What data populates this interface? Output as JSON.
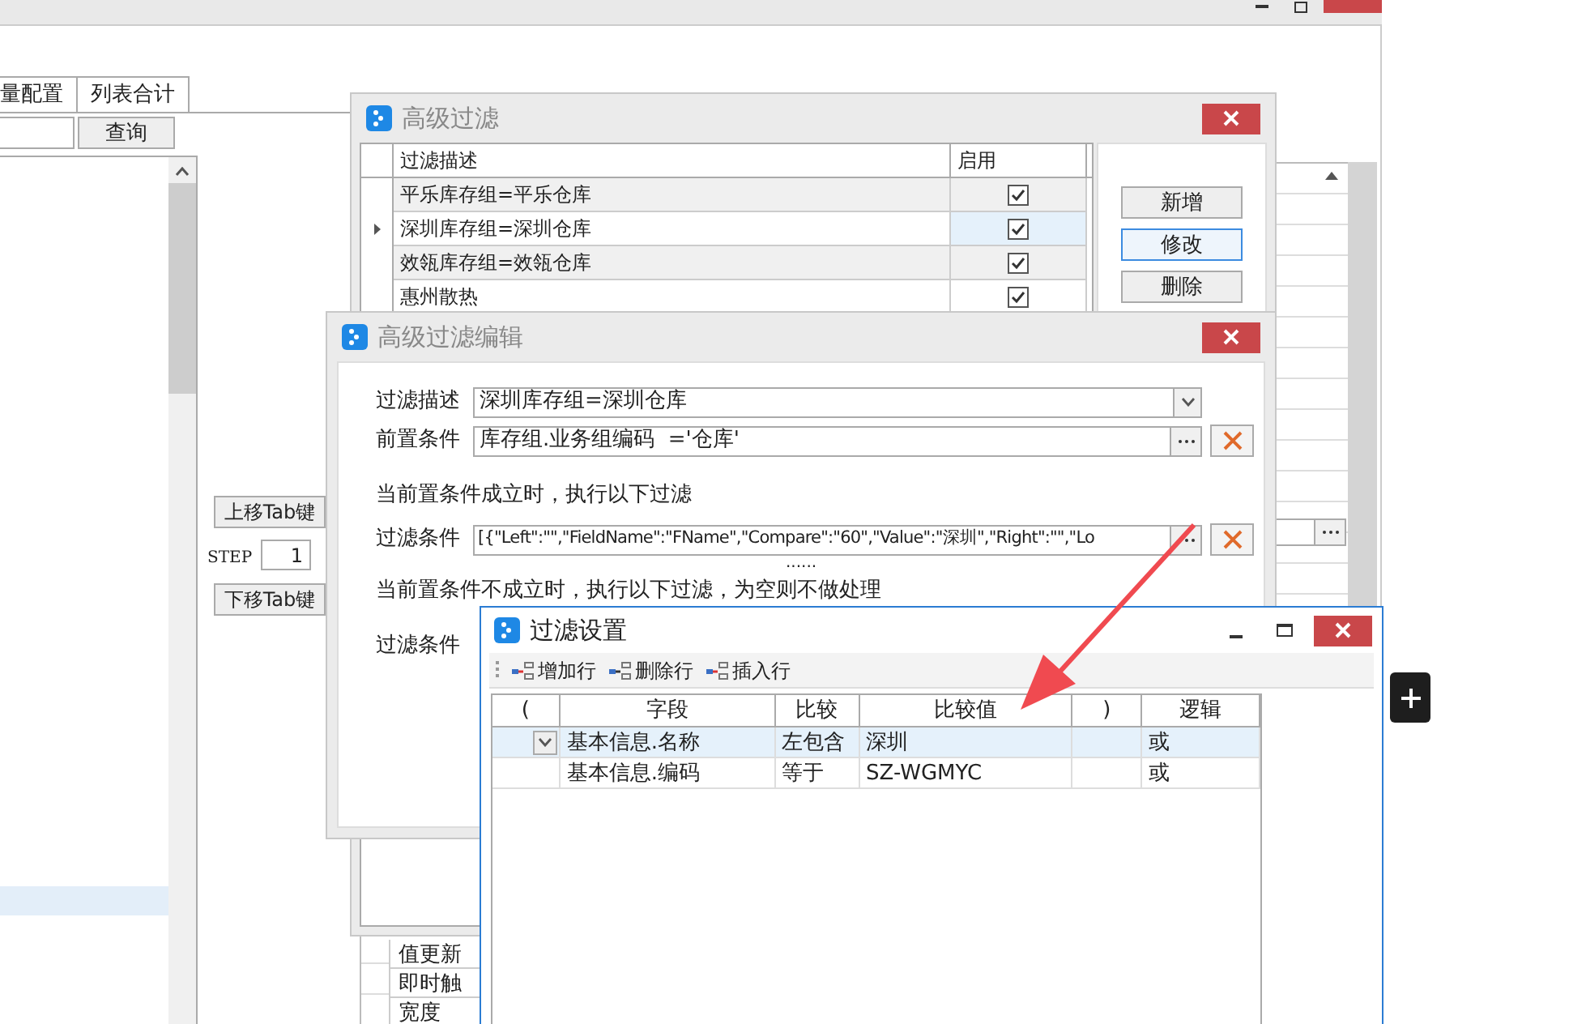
{
  "main_window": {
    "tabs": [
      "量配置",
      "列表合计"
    ],
    "search_button": "查询",
    "move_up_button": "上移Tab键",
    "step_label": "STEP",
    "step_value": "1",
    "move_down_button": "下移Tab键",
    "property_rows": [
      "值更新",
      "即时触",
      "宽度"
    ]
  },
  "advanced_filter": {
    "title": "高级过滤",
    "columns": [
      "过滤描述",
      "启用"
    ],
    "rows": [
      {
        "description": "平乐库存组=平乐仓库",
        "enabled": true,
        "selected": false
      },
      {
        "description": "深圳库存组=深圳仓库",
        "enabled": true,
        "selected": true
      },
      {
        "description": "效瓴库存组=效瓴仓库",
        "enabled": true,
        "selected": false
      },
      {
        "description": "惠州散热",
        "enabled": true,
        "selected": false
      }
    ],
    "buttons": [
      {
        "label": "新增",
        "focused": false
      },
      {
        "label": "修改",
        "focused": true
      },
      {
        "label": "删除",
        "focused": false
      }
    ]
  },
  "filter_editor": {
    "title": "高级过滤编辑",
    "description_label": "过滤描述",
    "description_value": "深圳库存组=深圳仓库",
    "precondition_label": "前置条件",
    "precondition_value": "库存组.业务组编码  ='仓库'",
    "true_caption": "当前置条件成立时，执行以下过滤",
    "condition_label": "过滤条件",
    "condition_value": "[{\"Left\":\"\",\"FieldName\":\"FName\",\"Compare\":\"60\",\"Value\":\"深圳\",\"Right\":\"\",\"Lo",
    "separator": "......",
    "false_caption": "当前置条件不成立时，执行以下过滤，为空则不做处理",
    "else_condition_label": "过滤条件"
  },
  "filter_settings": {
    "title": "过滤设置",
    "toolbar": [
      "增加行",
      "删除行",
      "插入行"
    ],
    "columns": [
      "(",
      "字段",
      "比较",
      "比较值",
      ")",
      "逻辑"
    ],
    "rows": [
      {
        "field": "基本信息.名称",
        "compare": "左包含",
        "value": "深圳",
        "logic": "或",
        "selected": true
      },
      {
        "field": "基本信息.编码",
        "compare": "等于",
        "value": "SZ-WGMYC",
        "logic": "或",
        "selected": false
      }
    ]
  }
}
